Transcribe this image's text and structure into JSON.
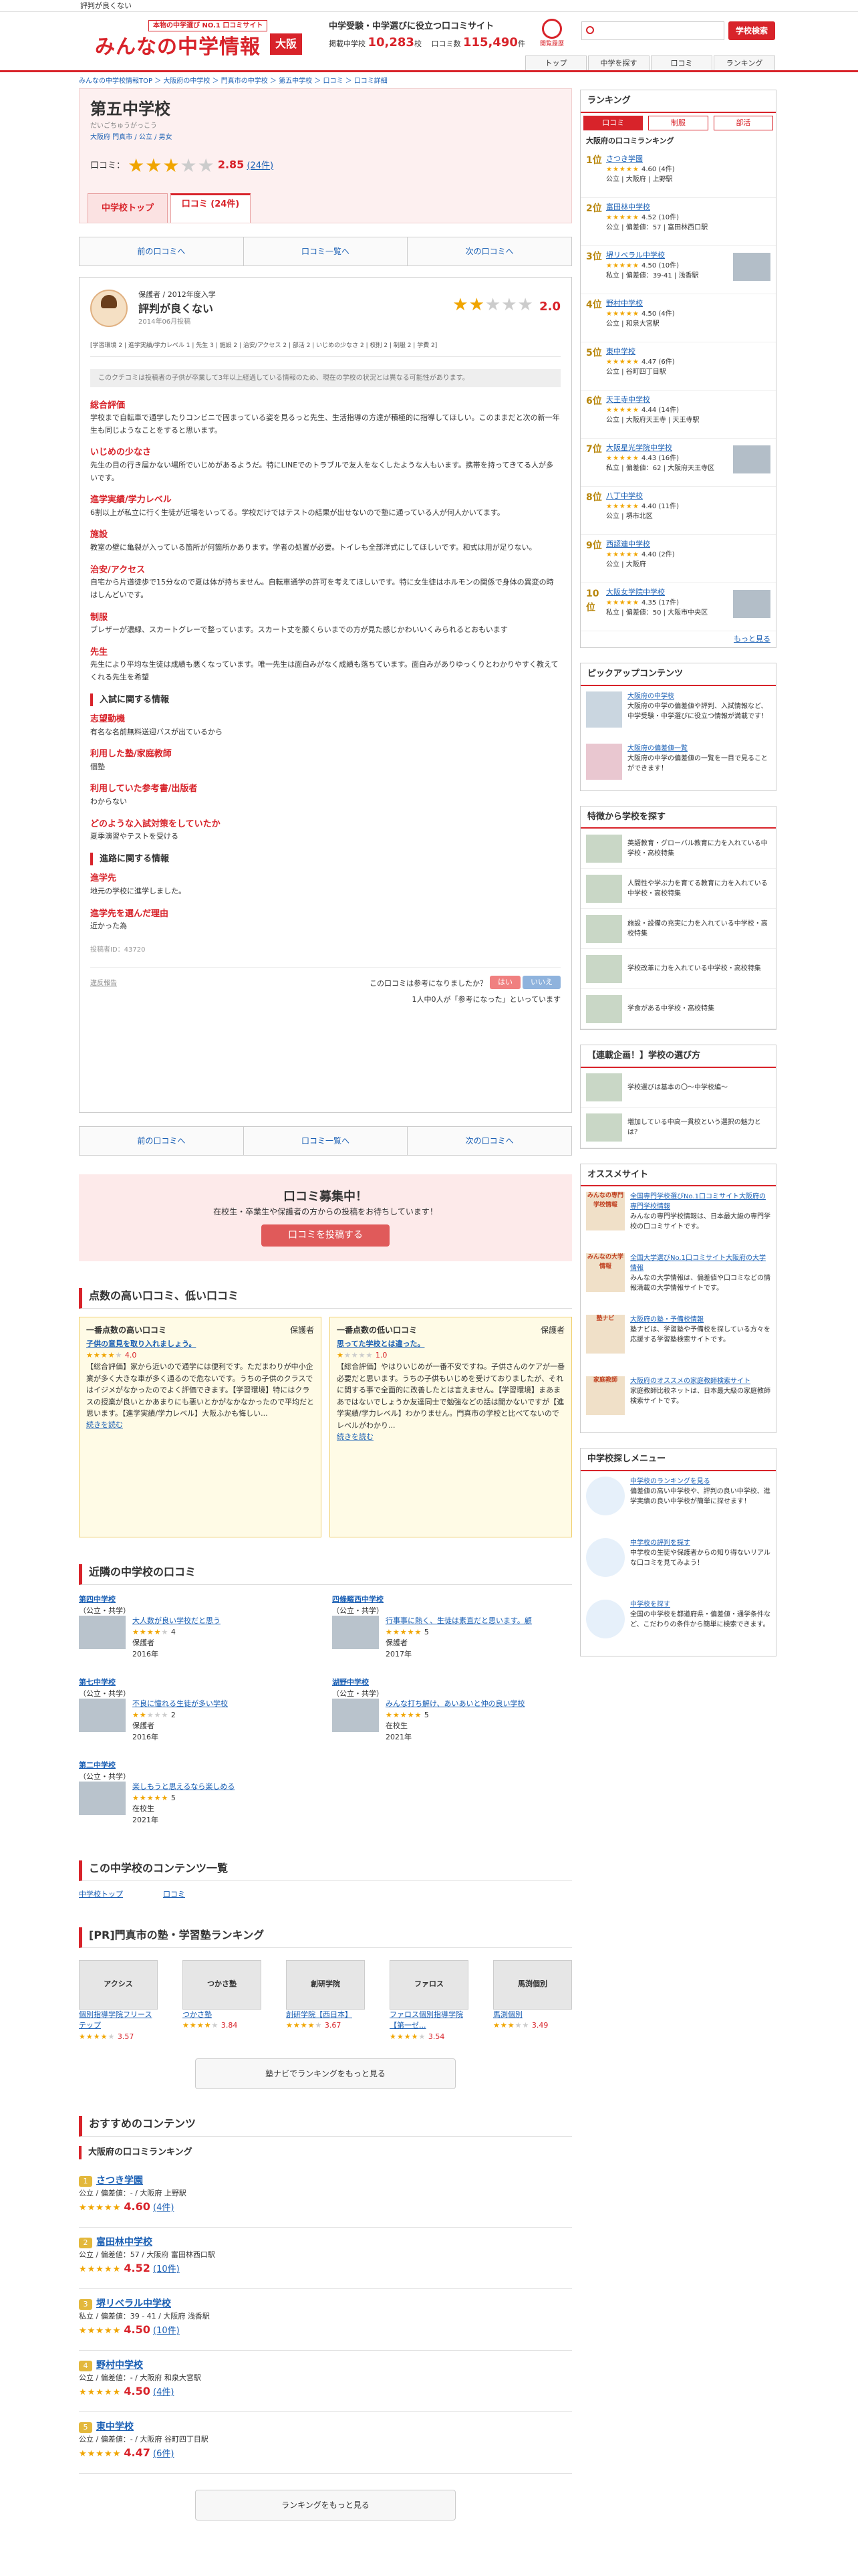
{
  "topbar": {
    "text": "評判が良くない"
  },
  "header": {
    "sub": "本物の中学選び NO.1 口コミサイト",
    "logo": "みんなの中学情報",
    "pref": "大阪",
    "info_title": "中学受験・中学選びに役立つ口コミサイト",
    "count_label1": "掲載中学校",
    "count1": "10,283",
    "unit1": "校",
    "count_label2": "口コミ数",
    "count2": "115,490",
    "unit2": "件",
    "clock_label": "閲覧履歴",
    "search_btn": "学校検索",
    "nav": [
      "トップ",
      "中学を探す",
      "口コミ",
      "ランキング"
    ]
  },
  "crumb": "みんなの中学校情報TOP ＞ 大阪府の中学校 ＞ 門真市の中学校 ＞ 第五中学校 ＞ 口コミ ＞ 口コミ詳細",
  "school": {
    "name": "第五中学校",
    "ruby": "だいごちゅうがっこう",
    "meta": "大阪府 門真市 / 公立 / 男女",
    "rating_label": "口コミ：",
    "rating": "2.85",
    "review_count": "(24件)",
    "tabs": [
      "中学校トップ",
      "口コミ (24件)"
    ]
  },
  "pager": [
    "前の口コミへ",
    "口コミ一覧へ",
    "次の口コミへ"
  ],
  "review": {
    "user": "保護者 / 2012年度入学",
    "title": "評判が良くない",
    "date": "2014年06月投稿",
    "score": "2.0",
    "subscores": "[学習環境 2 | 進学実績/学力レベル 1 | 先生 3 | 施設 2 | 治安/アクセス 2 | 部活 2 | いじめの少なさ 2 | 校則 2 | 制服 2 | 学費 2]",
    "notice": "このクチコミは投稿者の子供が卒業して3年以上経過している情報のため、現在の学校の状況とは異なる可能性があります。",
    "items": [
      {
        "h": "総合評価",
        "p": "学校まで自転車で通学したりコンビニで固まっている姿を見るっと先生、生活指導の方達が積極的に指導してほしい。このままだと次の新一年生も同じようなことをすると思います。"
      },
      {
        "h": "いじめの少なさ",
        "p": "先生の目の行き届かない場所でいじめがあるようだ。特にLINEでのトラブルで友人をなくしたような人もいます。携帯を持ってきてる人が多いです。"
      },
      {
        "h": "進学実績/学力レベル",
        "p": "6割以上が私立に行く生徒が近場をいってる。学校だけではテストの結果が出せないので塾に通っている人が何人かいてます。"
      },
      {
        "h": "施設",
        "p": "教室の壁に亀裂が入っている箇所が何箇所かあります。学者の処置が必要。トイレも全部洋式にしてほしいです。和式は用が足りない。"
      },
      {
        "h": "治安/アクセス",
        "p": "自宅から片道徒歩で15分なので夏は体が持ちません。自転車通学の許可を考えてほしいです。特に女生徒はホルモンの関係で身体の異変の時はしんどいです。"
      },
      {
        "h": "制服",
        "p": "ブレザーが濃緑、スカートグレーで整っています。スカート丈を膝くらいまでの方が見た感じかわいいくみられるとおもいます"
      },
      {
        "h": "先生",
        "p": "先生により平均な生徒は成績も悪くなっています。唯一先生は面白みがなく成績も落ちています。面白みがありゆっくりとわかりやすく教えてくれる先生を希望"
      }
    ],
    "sec1": "入試に関する情報",
    "items2": [
      {
        "h": "志望動機",
        "p": "有名な名前無料送迎バスが出ているから"
      },
      {
        "h": "利用した塾/家庭教師",
        "p": "個塾"
      },
      {
        "h": "利用していた参考書/出版者",
        "p": "わからない"
      },
      {
        "h": "どのような入試対策をしていたか",
        "p": "夏季演習やテストを受ける"
      }
    ],
    "sec2": "進路に関する情報",
    "items3": [
      {
        "h": "進学先",
        "p": "地元の学校に進学しました。"
      },
      {
        "h": "進学先を選んだ理由",
        "p": "近かった為"
      }
    ],
    "postid": "投稿者ID：43720",
    "report": "違反報告",
    "q": "この口コミは参考になりましたか？",
    "yes": "はい",
    "no": "いいえ",
    "cnt": "1人中0人が「参考になった」といっています"
  },
  "recruit": {
    "t": "口コミ募集中！",
    "s": "在校生・卒業生や保護者の方からの投稿をお待ちしています！",
    "b": "口コミを投稿する"
  },
  "hilo": {
    "h2": "点数の高い口コミ、低い口コミ",
    "hi": {
      "h": "一番点数の高い口コミ",
      "who": "保護者",
      "title": "子供の意見を取り入れましょう。",
      "score": "4.0",
      "body": "【総合評価】家から近いので通学には便利です。ただまわりが中小企業が多く大きな車が多く通るので危ないです。うちの子供のクラスではイジメがなかったのでよく評価できます。【学習環境】特にはクラスの授業が良いとかあまりにも悪いとかがなかなかったので平均だと思います。【進学実績/学力レベル】大阪ふかも悔しい...",
      "more": "続きを読む"
    },
    "lo": {
      "h": "一番点数の低い口コミ",
      "who": "保護者",
      "title": "思ってた学校とは違った。",
      "score": "1.0",
      "body": "【総合評価】やはりいじめが一番不安ですね。子供さんのケアが一番必要だと思います。うちの子供もいじめを受けておりましたが、それに関する事で全面的に改善したとは言えません。【学習環境】まあまあではないでしょうか友達同士で勉強などの話は聞かないですが【進学実績/学力レベル】わかりません。門真市の学校と比べてないのでレベルがわかり...",
      "more": "続きを読む"
    }
  },
  "near": {
    "h2": "近隣の中学校の口コミ",
    "list": [
      {
        "nm": "第四中学校",
        "type": "（公立・共学）",
        "t": "大人数が良い学校だと思う",
        "s": "4",
        "who": "保護者",
        "y": "2016年"
      },
      {
        "nm": "四條畷西中学校",
        "type": "（公立・共学）",
        "t": "行事事に熱く、生徒は素直だと思います。顧",
        "s": "5",
        "who": "保護者",
        "y": "2017年"
      },
      {
        "nm": "第七中学校",
        "type": "（公立・共学）",
        "t": "不良に憧れる生徒が多い学校",
        "s": "2",
        "who": "保護者",
        "y": "2016年"
      },
      {
        "nm": "湖野中学校",
        "type": "（公立・共学）",
        "t": "みんな打ち解け、あいあいと仲の良い学校",
        "s": "5",
        "who": "在校生",
        "y": "2021年"
      },
      {
        "nm": "第二中学校",
        "type": "（公立・共学）",
        "t": "楽しもうと思えるなら楽しめる",
        "s": "5",
        "who": "在校生",
        "y": "2021年"
      }
    ]
  },
  "contents": {
    "h2": "この中学校のコンテンツ一覧",
    "items": [
      "中学校トップ",
      "口コミ"
    ]
  },
  "juku": {
    "h2": "[PR]門真市の塾・学習塾ランキング",
    "items": [
      {
        "logo": "アクシス",
        "nm": "個別指導学院フリーステップ",
        "s": "3.57"
      },
      {
        "logo": "つかさ塾",
        "nm": "つかさ塾",
        "s": "3.84"
      },
      {
        "logo": "創研学院",
        "nm": "創研学院【西日本】",
        "s": "3.67"
      },
      {
        "logo": "ファロス",
        "nm": "ファロス個別指導学院【第一ゼ...",
        "s": "3.54"
      },
      {
        "logo": "馬渕個別",
        "nm": "馬渕個別",
        "s": "3.49"
      }
    ],
    "more": "塾ナビでランキングをもっと見る"
  },
  "recommend": {
    "h2": "おすすめのコンテンツ",
    "sub": "大阪府の口コミランキング",
    "list": [
      {
        "no": "1",
        "nm": "さつき学園",
        "m": "公立 / 偏差値：- / 大阪府 上野駅",
        "s": "4.60",
        "c": "(4件)"
      },
      {
        "no": "2",
        "nm": "富田林中学校",
        "m": "公立 / 偏差値：57 / 大阪府 富田林西口駅",
        "s": "4.52",
        "c": "(10件)"
      },
      {
        "no": "3",
        "nm": "堺リベラル中学校",
        "m": "私立 / 偏差値：39 - 41 / 大阪府 浅香駅",
        "s": "4.50",
        "c": "(10件)"
      },
      {
        "no": "4",
        "nm": "野村中学校",
        "m": "公立 / 偏差値：- / 大阪府 和泉大宮駅",
        "s": "4.50",
        "c": "(4件)"
      },
      {
        "no": "5",
        "nm": "東中学校",
        "m": "公立 / 偏差値：- / 大阪府 谷町四丁目駅",
        "s": "4.47",
        "c": "(6件)"
      }
    ],
    "more": "ランキングをもっと見る"
  },
  "side": {
    "rank_h": "ランキング",
    "tabs": [
      "口コミ",
      "制服",
      "部活"
    ],
    "rank_sub": "大阪府の口コミランキング",
    "ranks": [
      {
        "rk": "1位",
        "nm": "さつき学園",
        "s": "4.60",
        "c": "(4件)",
        "m": "公立 | 大阪府 | 上野駅"
      },
      {
        "rk": "2位",
        "nm": "富田林中学校",
        "s": "4.52",
        "c": "(10件)",
        "m": "公立 | 偏差値：57 | 富田林西口駅"
      },
      {
        "rk": "3位",
        "nm": "堺リベラル中学校",
        "s": "4.50",
        "c": "(10件)",
        "m": "私立 | 偏差値：39-41 | 浅香駅"
      },
      {
        "rk": "4位",
        "nm": "野村中学校",
        "s": "4.50",
        "c": "(4件)",
        "m": "公立 | 和泉大宮駅"
      },
      {
        "rk": "5位",
        "nm": "東中学校",
        "s": "4.47",
        "c": "(6件)",
        "m": "公立 | 谷町四丁目駅"
      },
      {
        "rk": "6位",
        "nm": "天王寺中学校",
        "s": "4.44",
        "c": "(14件)",
        "m": "公立 | 大阪府天王寺 | 天王寺駅"
      },
      {
        "rk": "7位",
        "nm": "大阪星光学院中学校",
        "s": "4.43",
        "c": "(16件)",
        "m": "私立 | 偏差値：62 | 大阪府天王寺区"
      },
      {
        "rk": "8位",
        "nm": "八丁中学校",
        "s": "4.40",
        "c": "(11件)",
        "m": "公立 | 堺市北区"
      },
      {
        "rk": "9位",
        "nm": "西認連中学校",
        "s": "4.40",
        "c": "(2件)",
        "m": "公立 | 大阪府"
      },
      {
        "rk": "10位",
        "nm": "大阪女学院中学校",
        "s": "4.35",
        "c": "(17件)",
        "m": "私立 | 偏差値：50 | 大阪市中央区"
      }
    ],
    "rank_more": "もっと見る",
    "pickup_h": "ピックアップコンテンツ",
    "pickups": [
      {
        "t": "大阪府の中学校",
        "d": "大阪府の中学の偏差値や評判、入試情報など、中学受験・中学選びに役立つ情報が満載です！"
      },
      {
        "t": "大阪府の偏差値一覧",
        "d": "大阪府の中学の偏差値の一覧を一目で見ることができます！"
      }
    ],
    "feat_h": "特徴から学校を探す",
    "feats": [
      "英語教育・グローバル教育に力を入れている中学校・高校特集",
      "人間性や学ぶ力を育てる教育に力を入れている中学校・高校特集",
      "施設・設備の充実に力を入れている中学校・高校特集",
      "学校改革に力を入れている中学校・高校特集",
      "学食がある中学校・高校特集"
    ],
    "serial_h": "【連載企画！】学校の選び方",
    "serials": [
      "学校選びは基本の〇〜中学校編〜",
      "増加している中高一貫校という選択の魅力とは？"
    ],
    "oss_h": "オススメサイト",
    "oss": [
      {
        "logo": "みんなの専門学校情報",
        "t": "全国専門学校選びNo.1口コミサイト大阪府の専門学校情報",
        "d": "みんなの専門学校情報は、日本最大級の専門学校の口コミサイトです。"
      },
      {
        "logo": "みんなの大学情報",
        "t": "全国大学選びNo.1口コミサイト大阪府の大学情報",
        "d": "みんなの大学情報は、偏差値や口コミなどの情報満載の大学情報サイトです。"
      },
      {
        "logo": "塾ナビ",
        "t": "大阪府の塾・予備校情報",
        "d": "塾ナビは、学習塾や予備校を探している方々を応援する学習塾検索サイトです。"
      },
      {
        "logo": "家庭教師",
        "t": "大阪府のオススメの家庭教師検索サイト",
        "d": "家庭教師比較ネットは、日本最大級の家庭教師検索サイトです。"
      }
    ],
    "menu_h": "中学校探しメニュー",
    "menu": [
      {
        "t": "中学校のランキングを見る",
        "d": "偏差値の高い中学校や、評判の良い中学校、進学実績の良い中学校が簡単に探せます！"
      },
      {
        "t": "中学校の評判を探す",
        "d": "中学校の生徒や保護者からの知り得ないリアルな口コミを見てみよう！"
      },
      {
        "t": "中学校を探す",
        "d": "全国の中学校を都道府県・偏差値・通学条件など、こだわりの条件から簡単に検索できます。"
      }
    ]
  }
}
